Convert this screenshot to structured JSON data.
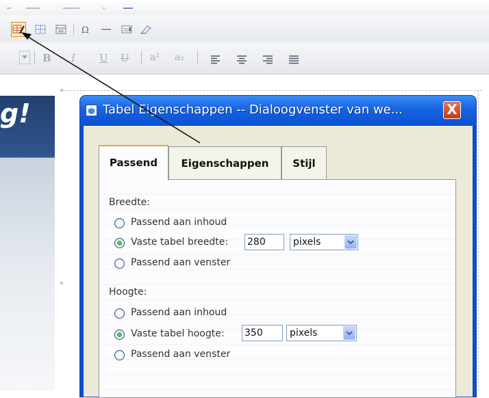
{
  "toolbar": {
    "font_strip": {
      "bold": "B",
      "italic": "I",
      "underline": "U",
      "strike": "U",
      "superscript": "a²",
      "subscript": "a₂"
    }
  },
  "banner": {
    "text": "g!"
  },
  "dialog": {
    "title": "Tabel Eigenschappen -- Dialoogvenster van we...",
    "close": "X",
    "tabs": [
      {
        "label": "Passend"
      },
      {
        "label": "Eigenschappen"
      },
      {
        "label": "Stijl"
      }
    ],
    "width": {
      "heading": "Breedte:",
      "opt_fit_content": "Passend aan inhoud",
      "opt_fixed": "Vaste tabel breedte:",
      "value": "280",
      "unit": "pixels",
      "opt_fit_window": "Passend aan venster",
      "selected": "fixed"
    },
    "height": {
      "heading": "Hoogte:",
      "opt_fit_content": "Passend aan inhoud",
      "opt_fixed": "Vaste tabel hoogte:",
      "value": "350",
      "unit": "pixels",
      "opt_fit_window": "Passend aan venster",
      "selected": "fixed"
    }
  },
  "colors": {
    "title_bar": "#1763e0",
    "dialog_body": "#ece9d8",
    "active_button": "#fde9c2",
    "close_button": "#c23a1c",
    "banner": "#23406f"
  }
}
